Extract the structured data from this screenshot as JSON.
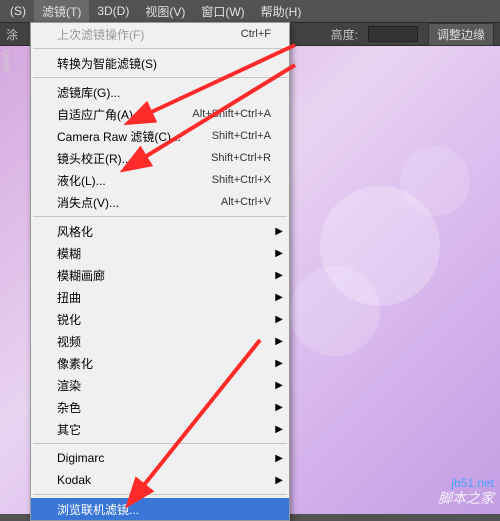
{
  "menubar": {
    "items": [
      {
        "label": "(S)"
      },
      {
        "label": "滤镜(T)"
      },
      {
        "label": "3D(D)"
      },
      {
        "label": "视图(V)"
      },
      {
        "label": "窗口(W)"
      },
      {
        "label": "帮助(H)"
      }
    ]
  },
  "toolbar": {
    "height_label": "高度:",
    "height_value": "",
    "adjust_button": "调整边缘"
  },
  "side_panel_label": "ower",
  "menu": {
    "last_filter": {
      "label": "上次滤镜操作(F)",
      "shortcut": "Ctrl+F"
    },
    "convert_smart": {
      "label": "转换为智能滤镜(S)"
    },
    "filter_gallery": {
      "label": "滤镜库(G)..."
    },
    "adaptive_wide": {
      "label": "自适应广角(A)...",
      "shortcut": "Alt+Shift+Ctrl+A"
    },
    "camera_raw": {
      "label": "Camera Raw 滤镜(C)...",
      "shortcut": "Shift+Ctrl+A"
    },
    "lens_correction": {
      "label": "镜头校正(R)...",
      "shortcut": "Shift+Ctrl+R"
    },
    "liquify": {
      "label": "液化(L)...",
      "shortcut": "Shift+Ctrl+X"
    },
    "vanishing_point": {
      "label": "消失点(V)...",
      "shortcut": "Alt+Ctrl+V"
    },
    "stylize": {
      "label": "风格化"
    },
    "blur": {
      "label": "模糊"
    },
    "blur_gallery": {
      "label": "模糊画廊"
    },
    "distort": {
      "label": "扭曲"
    },
    "sharpen": {
      "label": "锐化"
    },
    "video": {
      "label": "视频"
    },
    "pixelate": {
      "label": "像素化"
    },
    "render": {
      "label": "渲染"
    },
    "noise": {
      "label": "杂色"
    },
    "other": {
      "label": "其它"
    },
    "digimarc": {
      "label": "Digimarc"
    },
    "kodak": {
      "label": "Kodak"
    },
    "browse_online": {
      "label": "浏览联机滤镜..."
    }
  },
  "watermark": {
    "site": "jb51.net",
    "text": "脚本之家"
  },
  "arrow_color": "#ff2a2a"
}
